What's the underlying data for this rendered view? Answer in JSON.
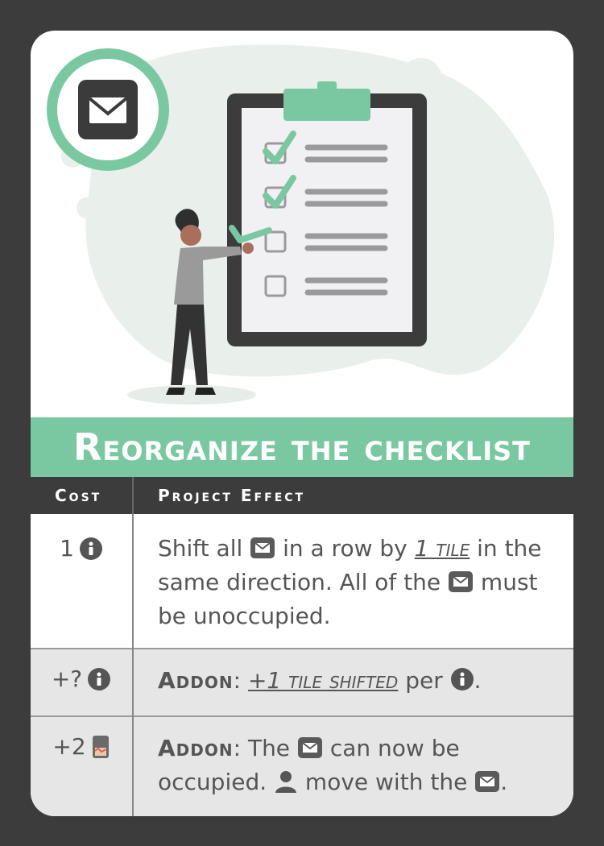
{
  "card": {
    "title": "Reorganize the checklist",
    "type_icon": "envelope-icon",
    "colors": {
      "accent": "#7ac8a2",
      "frame": "#3c3c3c",
      "text": "#555555",
      "row_alt": "#e6e6e6"
    }
  },
  "table": {
    "header_cost": "Cost",
    "header_effect": "Project Effect",
    "rows": [
      {
        "cost_value": "1",
        "cost_icon": "info-icon",
        "effect_a": "Shift all ",
        "effect_b": " in a row by ",
        "effect_emph": "1 tile",
        "effect_c": " in the same direction. All of the ",
        "effect_d": " must be unoccupied."
      },
      {
        "cost_value": "+?",
        "cost_icon": "info-icon",
        "addon_label": "Addon",
        "effect_a": ": ",
        "effect_emph": "+1 tile shifted",
        "effect_b": " per ",
        "effect_c": "."
      },
      {
        "cost_value": "+2",
        "cost_icon": "card-icon",
        "addon_label": "Addon",
        "effect_a": ": The ",
        "effect_b": " can now be occupied. ",
        "effect_c": " move with the ",
        "effect_d": "."
      }
    ]
  }
}
